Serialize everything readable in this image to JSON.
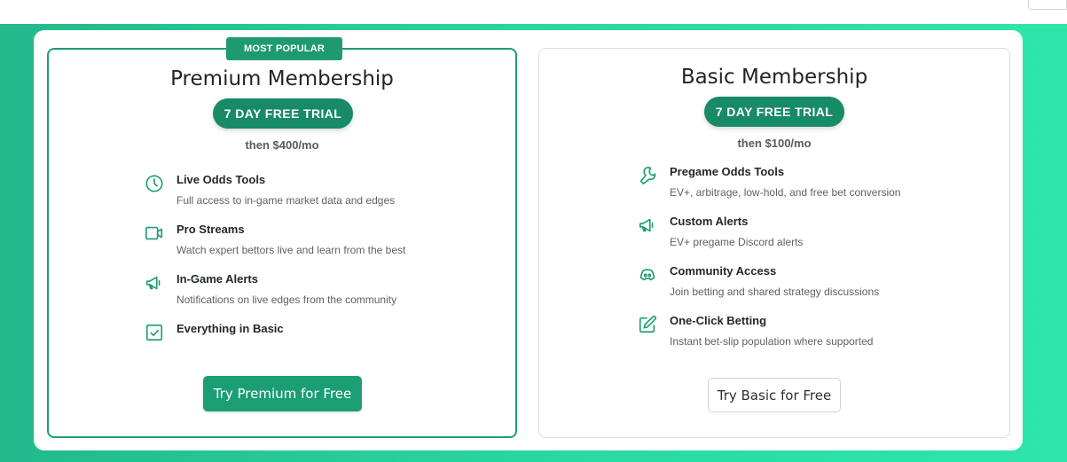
{
  "premium": {
    "badge": "MOST POPULAR",
    "title": "Premium Membership",
    "trial": "7 DAY FREE TRIAL",
    "price": "then $400/mo",
    "features": [
      {
        "icon": "clock-icon",
        "name": "Live Odds Tools",
        "desc": "Full access to in-game market data and edges"
      },
      {
        "icon": "video-camera-icon",
        "name": "Pro Streams",
        "desc": "Watch expert bettors live and learn from the best"
      },
      {
        "icon": "megaphone-icon",
        "name": "In-Game Alerts",
        "desc": "Notifications on live edges from the community"
      },
      {
        "icon": "checkbox-icon",
        "name": "Everything in Basic",
        "desc": ""
      }
    ],
    "cta": "Try Premium for Free"
  },
  "basic": {
    "title": "Basic Membership",
    "trial": "7 DAY FREE TRIAL",
    "price": "then $100/mo",
    "features": [
      {
        "icon": "wrench-icon",
        "name": "Pregame Odds Tools",
        "desc": "EV+, arbitrage, low-hold, and free bet conversion"
      },
      {
        "icon": "megaphone-icon",
        "name": "Custom Alerts",
        "desc": "EV+ pregame Discord alerts"
      },
      {
        "icon": "discord-icon",
        "name": "Community Access",
        "desc": "Join betting and shared strategy discussions"
      },
      {
        "icon": "edit-icon",
        "name": "One-Click Betting",
        "desc": "Instant bet-slip population where supported"
      }
    ],
    "cta": "Try Basic for Free"
  },
  "colors": {
    "accent": "#1e9e74",
    "background_gradient_start": "#22b98b",
    "background_gradient_end": "#2fe6aa"
  }
}
